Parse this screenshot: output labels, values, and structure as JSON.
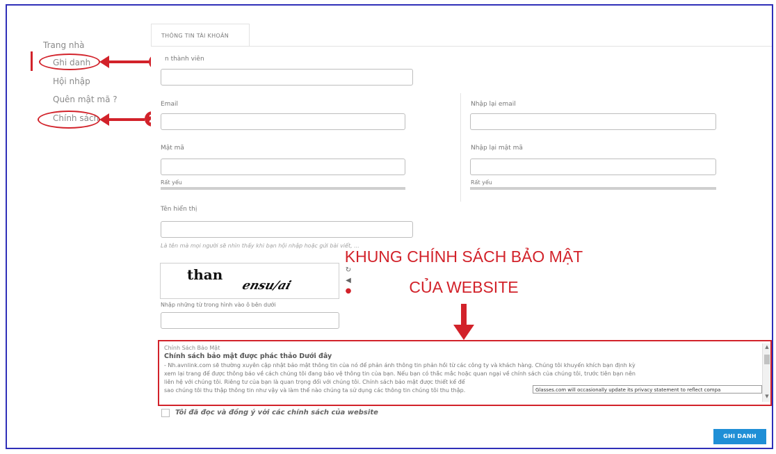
{
  "sidebar": {
    "items": [
      {
        "label": "Trang nhà"
      },
      {
        "label": "Ghi danh"
      },
      {
        "label": "Hội nhập"
      },
      {
        "label": "Quên mật mã ?"
      },
      {
        "label": "Chính sách"
      }
    ],
    "markers": [
      "1",
      "2"
    ]
  },
  "tab": {
    "label": "THÔNG TIN TÀI KHOẢN"
  },
  "form": {
    "member_name_label": "n thành viên",
    "email_label": "Email",
    "email_confirm_label": "Nhập lại email",
    "password_label": "Mật mã",
    "password_confirm_label": "Nhập lại mật mã",
    "strength_1": "Rất yếu",
    "strength_2": "Rất yếu",
    "display_name_label": "Tên hiển thị",
    "display_name_hint": "Là tên mà mọi người sẽ nhìn thấy khi bạn hội nhập hoặc gửi bài viết, ...",
    "captcha_word_1": "than",
    "captcha_word_2": "ensu/ai",
    "captcha_instruction": "Nhập những từ trong hình vào ô bên dưới"
  },
  "annotation": {
    "line_1": "KHUNG CHÍNH SÁCH BẢO MẬT",
    "line_2": "CỦA WEBSITE"
  },
  "policy": {
    "small_title": "Chính Sách Bảo Mật",
    "heading": "Chính sách bảo mật được phác thảo Dưới đây",
    "lines": [
      "- Nh.avnlink.com sẽ thường xuyên cập nhật bảo mật thông tin của nó để phản ánh thông tin phản hồi từ các công ty và khách hàng. Chúng tôi khuyến khích bạn định kỳ",
      "xem lại trang để được thông báo về cách chúng tôi đang bảo vệ thông tin của bạn. Nếu bạn có thắc mắc hoặc quan ngại về chính sách của chúng tôi, trước tiên bạn nên",
      "liên hệ với chúng tôi. Riêng tư của bạn là quan trọng đối với chúng tôi. Chính sách bảo mật được thiết kế để",
      "sao chúng tôi thu thập thông tin như vậy và làm thế nào chúng ta sử dụng các thông tin chúng tôi thu thập."
    ],
    "tooltip": "Glasses.com will occasionally update its privacy statement to reflect compa"
  },
  "agree": {
    "label": "Tôi đã đọc và đồng ý với các chính sách của website"
  },
  "submit": {
    "label": "GHI DANH"
  },
  "colors": {
    "accent_red": "#d2222a",
    "button_blue": "#1f8fd6",
    "frame_blue": "#2f2fb8"
  }
}
